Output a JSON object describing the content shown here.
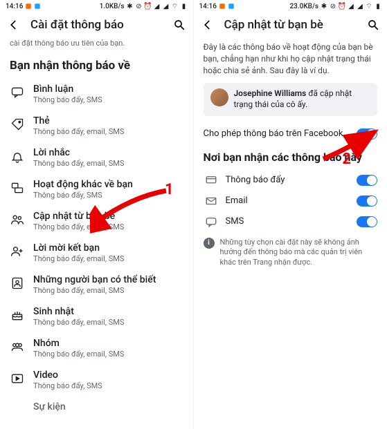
{
  "left": {
    "status": {
      "time": "14:16",
      "net": "1.0KB/s"
    },
    "header": {
      "title": "Cài đặt thông báo"
    },
    "top_text": "cài đặt thông báo ưu tiên của bạn.",
    "section_title": "Bạn nhận thông báo về",
    "items": [
      {
        "title": "Bình luận",
        "sub": "Thông báo đẩy, SMS"
      },
      {
        "title": "Thẻ",
        "sub": "Thông báo đẩy, email, SMS"
      },
      {
        "title": "Lời nhắc",
        "sub": "Thông báo đẩy, email, SMS"
      },
      {
        "title": "Hoạt động khác về bạn",
        "sub": "Thông báo đẩy, SMS"
      },
      {
        "title": "Cập nhật từ bạn bè",
        "sub": "Thông báo đẩy, email, SMS"
      },
      {
        "title": "Lời mời kết bạn",
        "sub": "Thông báo đẩy, email, SMS"
      },
      {
        "title": "Những người bạn có thể biết",
        "sub": "Thông báo đẩy, email, SMS"
      },
      {
        "title": "Sinh nhật",
        "sub": "Thông báo đẩy, email, SMS"
      },
      {
        "title": "Nhóm",
        "sub": "Thông báo đẩy, email, SMS"
      },
      {
        "title": "Video",
        "sub": "Thông báo đẩy, SMS"
      },
      {
        "title": "Sự kiện",
        "sub": ""
      }
    ]
  },
  "right": {
    "status": {
      "time": "14:16",
      "net": "23.0KB/s"
    },
    "header": {
      "title": "Cập nhật từ bạn bè"
    },
    "description": "Đây là các thông báo về hoạt động của bạn bè bạn, chẳng hạn như khi họ cập nhật trạng thái hoặc chia sẻ ảnh. Sau đây là ví dụ.",
    "example": {
      "name": "Josephine Williams",
      "rest": " đã cập nhật trạng thái của cô ấy."
    },
    "allow_label": "Cho phép thông báo trên Facebook",
    "section_title": "Nơi bạn nhận các thông báo này",
    "channels": [
      {
        "label": "Thông báo đẩy"
      },
      {
        "label": "Email"
      },
      {
        "label": "SMS"
      }
    ],
    "info": "Những tùy chọn cài đặt này sẽ không ảnh hưởng đến thông báo mà các quản trị viên khác trên Trang nhận được."
  },
  "annotations": {
    "one": "1",
    "two": "2"
  }
}
